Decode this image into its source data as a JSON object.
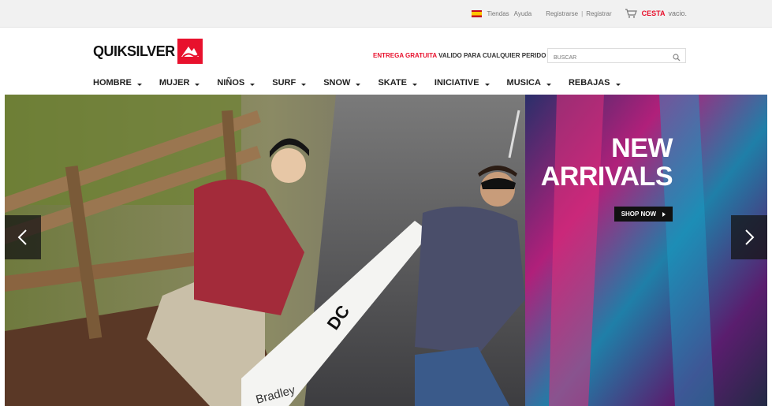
{
  "topbar": {
    "flag_icon": "spain-flag-icon",
    "stores_label": "Tiendas",
    "help_label": "Ayuda",
    "register_label": "Registrarse",
    "separator": "|",
    "register_label_2": "Registrar",
    "cart_icon": "shopping-cart-icon",
    "cart_label": "CESTA",
    "cart_status": "vacio."
  },
  "header": {
    "logo_text": "QUIKSILVER",
    "promo_red": "ENTREGA GRATUITA",
    "promo_rest": "VALIDO PARA CUALQUIER PERIDO",
    "search_placeholder": "BUSCAR"
  },
  "nav": {
    "items": [
      "HOMBRE",
      "MUJER",
      "NIÑOS",
      "SURF",
      "SNOW",
      "SKATE",
      "INICIATIVE",
      "MUSICA",
      "REBAJAS"
    ]
  },
  "hero": {
    "headline_line1": "NEW",
    "headline_line2": "ARRIVALS",
    "cta_label": "SHOP NOW",
    "prev_icon": "chevron-left-icon",
    "next_icon": "chevron-right-icon",
    "board_brand": "DC",
    "board_text": "Bradley"
  },
  "colors": {
    "brand_red": "#e8112d",
    "topbar_bg": "#f1f1f1",
    "text_dark": "#222222"
  }
}
